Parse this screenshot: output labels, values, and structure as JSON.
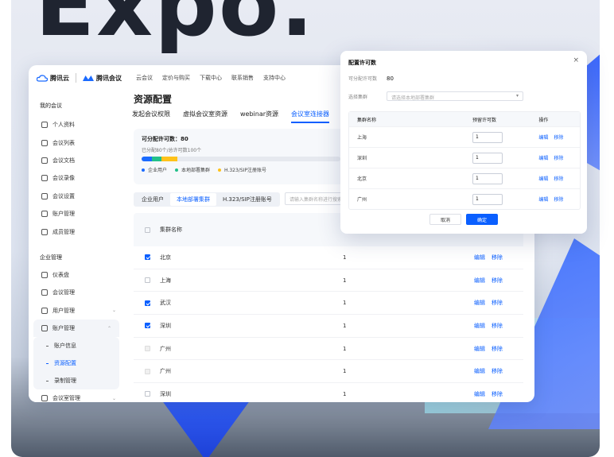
{
  "headline": "Expo.",
  "app": {
    "brand_tencent": "腾讯云",
    "brand_meeting": "腾讯会议",
    "topnav": [
      "云会议",
      "定价与购买",
      "下载中心",
      "联系销售",
      "支持中心"
    ]
  },
  "sidebar": {
    "my_meeting_title": "我的会议",
    "my_items": [
      {
        "label": "个人资料",
        "icon": "user-icon"
      },
      {
        "label": "会议列表",
        "icon": "list-icon"
      },
      {
        "label": "会议文档",
        "icon": "document-icon"
      },
      {
        "label": "会议录像",
        "icon": "record-icon"
      },
      {
        "label": "会议设置",
        "icon": "settings-icon"
      },
      {
        "label": "账户管理",
        "icon": "account-icon"
      },
      {
        "label": "成员管理",
        "icon": "members-icon"
      }
    ],
    "enterprise_title": "企业管理",
    "ent_items": [
      {
        "label": "仪表盘",
        "icon": "dashboard-icon"
      },
      {
        "label": "会议管理",
        "icon": "meeting-manage-icon"
      },
      {
        "label": "用户管理",
        "icon": "users-icon",
        "chevron": "⌄"
      },
      {
        "label": "账户管理",
        "icon": "account-icon",
        "chevron": "⌃"
      }
    ],
    "account_sub": [
      {
        "label": "账户信息",
        "active": false
      },
      {
        "label": "资源配置",
        "active": true
      },
      {
        "label": "录制管理",
        "active": false
      }
    ],
    "room_manage": {
      "label": "会议室管理",
      "icon": "room-icon",
      "chevron": "⌄"
    }
  },
  "main": {
    "page_title": "资源配置",
    "tabs": [
      {
        "label": "发起会议权限",
        "active": false
      },
      {
        "label": "虚拟会议室资源",
        "active": false
      },
      {
        "label": "webinar资源",
        "active": false
      },
      {
        "label": "会议室连接器",
        "active": true
      }
    ],
    "quota": {
      "title": "可分配许可数：80",
      "subtitle": "已分配80个/总许可数100个",
      "segments": [
        {
          "share": 0.05,
          "color": "#1b6bff"
        },
        {
          "share": 0.05,
          "color": "#22c08a"
        },
        {
          "share": 0.08,
          "color": "#ffc21a"
        }
      ],
      "legend": [
        {
          "label": "企业用户",
          "color": "#1b6bff"
        },
        {
          "label": "本地部署集群",
          "color": "#22c08a"
        },
        {
          "label": "H.323/SIP注册账号",
          "color": "#ffc21a"
        }
      ]
    },
    "subtabs": [
      {
        "label": "企业用户",
        "active": false
      },
      {
        "label": "本地部署集群",
        "active": true
      },
      {
        "label": "H.323/SIP注册账号",
        "active": false
      }
    ],
    "search_placeholder": "请输入集群名称进行搜索",
    "table": {
      "header_name": "集群名称",
      "edit_label": "编辑",
      "remove_label": "移除",
      "rows": [
        {
          "name": "北京",
          "count": "1",
          "state": "checked"
        },
        {
          "name": "上海",
          "count": "1",
          "state": "unchecked"
        },
        {
          "name": "武汉",
          "count": "1",
          "state": "checked"
        },
        {
          "name": "深圳",
          "count": "1",
          "state": "checked"
        },
        {
          "name": "广州",
          "count": "1",
          "state": "disabled"
        },
        {
          "name": "广州",
          "count": "1",
          "state": "disabled"
        },
        {
          "name": "深圳",
          "count": "1",
          "state": "unchecked"
        }
      ]
    }
  },
  "dialog": {
    "title": "配置许可数",
    "close": "×",
    "available_label": "可分配许可数",
    "available_value": "80",
    "select_label": "选择集群",
    "select_placeholder": "请选择本地部署集群",
    "col_name": "集群名称",
    "col_quota": "预留许可数",
    "col_ops": "操作",
    "edit_label": "编辑",
    "remove_label": "移除",
    "rows": [
      {
        "name": "上海",
        "quota": "1"
      },
      {
        "name": "深圳",
        "quota": "1"
      },
      {
        "name": "北京",
        "quota": "1"
      },
      {
        "name": "广州",
        "quota": "1"
      }
    ],
    "cancel_label": "取消",
    "ok_label": "确定"
  }
}
